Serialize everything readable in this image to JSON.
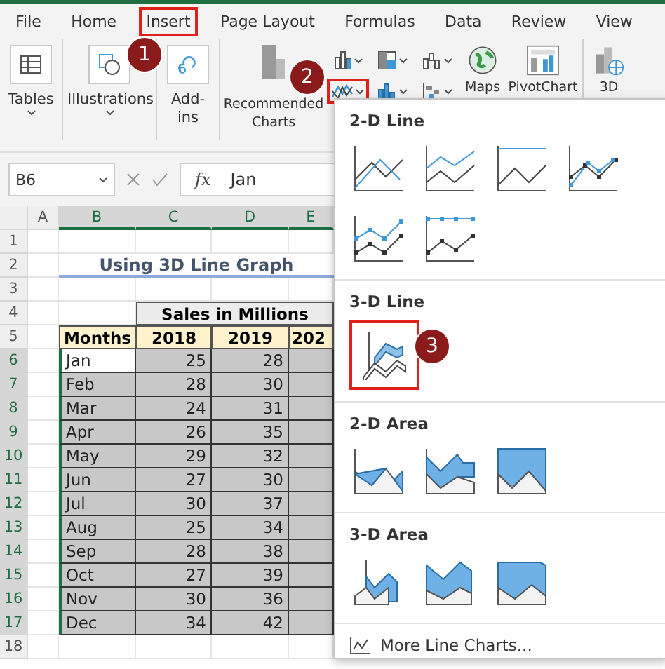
{
  "tabs": [
    {
      "label": "File",
      "selected": false
    },
    {
      "label": "Home",
      "selected": false
    },
    {
      "label": "Insert",
      "selected": true
    },
    {
      "label": "Page Layout",
      "selected": false
    },
    {
      "label": "Formulas",
      "selected": false
    },
    {
      "label": "Data",
      "selected": false
    },
    {
      "label": "Review",
      "selected": false
    },
    {
      "label": "View",
      "selected": false
    }
  ],
  "ribbon": {
    "groups": [
      {
        "kind": "tables",
        "label": "Tables"
      },
      {
        "kind": "illustrations",
        "label": "Illustrations"
      },
      {
        "kind": "addins",
        "label": "Add-ins"
      },
      {
        "kind": "recommended",
        "label": "Recommended Charts"
      },
      {
        "kind": "charts"
      },
      {
        "kind": "maps",
        "label": "Maps"
      },
      {
        "kind": "pivot",
        "label": "PivotChart"
      },
      {
        "kind": "map3d",
        "label": "3D"
      }
    ],
    "chart_buttons": [
      {
        "kind": "column",
        "selected": false
      },
      {
        "kind": "hierarchy",
        "selected": false
      },
      {
        "kind": "waterfall",
        "selected": false
      },
      {
        "kind": "line",
        "selected": true
      },
      {
        "kind": "statistic",
        "selected": false
      },
      {
        "kind": "scatter",
        "selected": false
      }
    ]
  },
  "markers": [
    {
      "number": "1"
    },
    {
      "number": "2"
    },
    {
      "number": "3"
    }
  ],
  "formula_bar": {
    "name_box": "B6",
    "function_label": "fx",
    "value": "Jan"
  },
  "sheet": {
    "columns": [
      "A",
      "B",
      "C",
      "D",
      "E"
    ],
    "row_numbers": [
      "1",
      "2",
      "3",
      "4",
      "5",
      "6",
      "7",
      "8",
      "9",
      "10",
      "11",
      "12",
      "13",
      "14",
      "15",
      "16",
      "17",
      "18"
    ],
    "title": "Using 3D Line Graph",
    "group_header": "Sales in Millions",
    "headers": [
      "Months",
      "2018",
      "2019",
      "202"
    ],
    "rows": [
      {
        "month": "Jan",
        "values": [
          "25",
          "28"
        ],
        "active": true
      },
      {
        "month": "Feb",
        "values": [
          "28",
          "30"
        ],
        "active": false
      },
      {
        "month": "Mar",
        "values": [
          "24",
          "31"
        ],
        "active": false
      },
      {
        "month": "Apr",
        "values": [
          "26",
          "35"
        ],
        "active": false
      },
      {
        "month": "May",
        "values": [
          "29",
          "32"
        ],
        "active": false
      },
      {
        "month": "Jun",
        "values": [
          "27",
          "30"
        ],
        "active": false
      },
      {
        "month": "Jul",
        "values": [
          "30",
          "37"
        ],
        "active": false
      },
      {
        "month": "Aug",
        "values": [
          "25",
          "34"
        ],
        "active": false
      },
      {
        "month": "Sep",
        "values": [
          "28",
          "38"
        ],
        "active": false
      },
      {
        "month": "Oct",
        "values": [
          "27",
          "39"
        ],
        "active": false
      },
      {
        "month": "Nov",
        "values": [
          "30",
          "36"
        ],
        "active": false
      },
      {
        "month": "Dec",
        "values": [
          "34",
          "42"
        ],
        "active": false
      }
    ]
  },
  "dropdown": {
    "sections": [
      {
        "title": "2-D Line",
        "charts": [
          {
            "kind": "line",
            "selected": false
          },
          {
            "kind": "stacked-line",
            "selected": false
          },
          {
            "kind": "full-line",
            "selected": false
          },
          {
            "kind": "marker-line",
            "selected": false
          },
          {
            "kind": "stacked-marker-line",
            "selected": false
          },
          {
            "kind": "full-marker-line",
            "selected": false
          }
        ]
      },
      {
        "title": "3-D Line",
        "charts": [
          {
            "kind": "line3d",
            "selected": true
          }
        ]
      },
      {
        "title": "2-D Area",
        "charts": [
          {
            "kind": "area",
            "selected": false
          },
          {
            "kind": "stacked-area",
            "selected": false
          },
          {
            "kind": "full-area",
            "selected": false
          }
        ]
      },
      {
        "title": "3-D Area",
        "charts": [
          {
            "kind": "area3d",
            "selected": false
          },
          {
            "kind": "stackedarea3d",
            "selected": false
          },
          {
            "kind": "fullarea3d",
            "selected": false
          }
        ]
      }
    ],
    "footer": "More Line Charts..."
  }
}
